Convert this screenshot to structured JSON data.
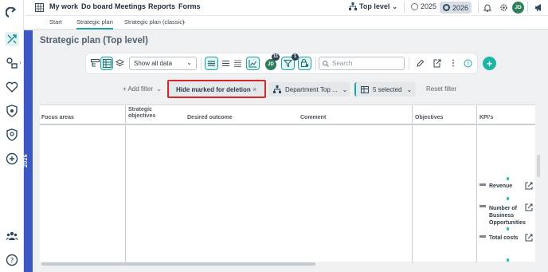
{
  "topnav": {
    "items": [
      "My work",
      "Do board",
      "Meetings",
      "Reports",
      "Forms"
    ],
    "level_label": "Top level",
    "years": [
      "2025",
      "2026"
    ],
    "avatar": "JD"
  },
  "subnav": {
    "tabs": [
      "Start",
      "Strategic plan",
      "Strategic plan (classic)"
    ]
  },
  "sidebar": {
    "year": "2026"
  },
  "page": {
    "title": "Strategic plan (Top level)"
  },
  "toolbar": {
    "show_select": "Show all data",
    "search_placeholder": "Search",
    "avatar": "JD",
    "avatar_badge": "11",
    "filter_badge": "1"
  },
  "filters": {
    "add_filter": "+ Add filter",
    "hide_deleted": "Hide marked for deletion",
    "department": "Department Top ...",
    "selected": "5 selected",
    "reset": "Reset filter"
  },
  "table": {
    "columns": [
      "Focus areas",
      "Strategic objectives",
      "Desired outcome",
      "Comment",
      "Objectives",
      "KPI's"
    ]
  },
  "kpis": [
    {
      "label": "Revenue"
    },
    {
      "label": "Number of Business Opportunities"
    },
    {
      "label": "Total costs"
    }
  ],
  "colors": {
    "accent": "#1aa3a3",
    "year_bar": "#3a57c4",
    "highlight": "#d9262b",
    "add_button": "#1bb5a3"
  }
}
